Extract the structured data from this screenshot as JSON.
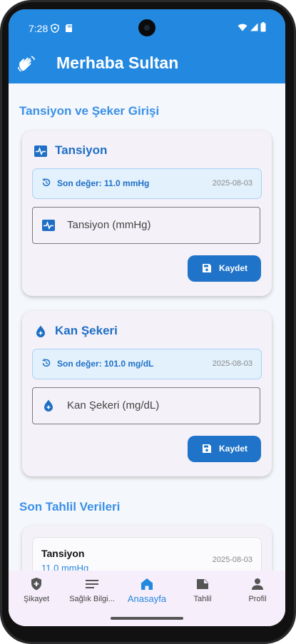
{
  "status": {
    "time": "7:28"
  },
  "app": {
    "title": "Merhaba Sultan"
  },
  "entry_section": {
    "title": "Tansiyon ve Şeker Girişi"
  },
  "cards": {
    "bp": {
      "title": "Tansiyon",
      "last_value": "Son değer: 11.0 mmHg",
      "last_date": "2025-08-03",
      "placeholder": "Tansiyon (mmHg)",
      "save_label": "Kaydet"
    },
    "sugar": {
      "title": "Kan Şekeri",
      "last_value": "Son değer: 101.0 mg/dL",
      "last_date": "2025-08-03",
      "placeholder": "Kan Şekeri (mg/dL)",
      "save_label": "Kaydet"
    }
  },
  "lab_section": {
    "title": "Son Tahlil Verileri"
  },
  "lab_items": [
    {
      "name": "Tansiyon",
      "value": "11.0 mmHg",
      "date": "2025-08-03"
    }
  ],
  "nav": {
    "items": [
      {
        "label": "Şikayet",
        "icon": "shield-plus-icon"
      },
      {
        "label": "Sağlık Bilgi...",
        "icon": "lines-icon"
      },
      {
        "label": "Anasayfa",
        "icon": "home-icon",
        "active": true
      },
      {
        "label": "Tahlil",
        "icon": "file-icon"
      },
      {
        "label": "Profil",
        "icon": "person-icon"
      }
    ]
  },
  "colors": {
    "primary": "#2388e0",
    "dark_primary": "#1f73c8",
    "card_bg": "#f5f1f8",
    "nav_bg": "#f6eefa"
  }
}
